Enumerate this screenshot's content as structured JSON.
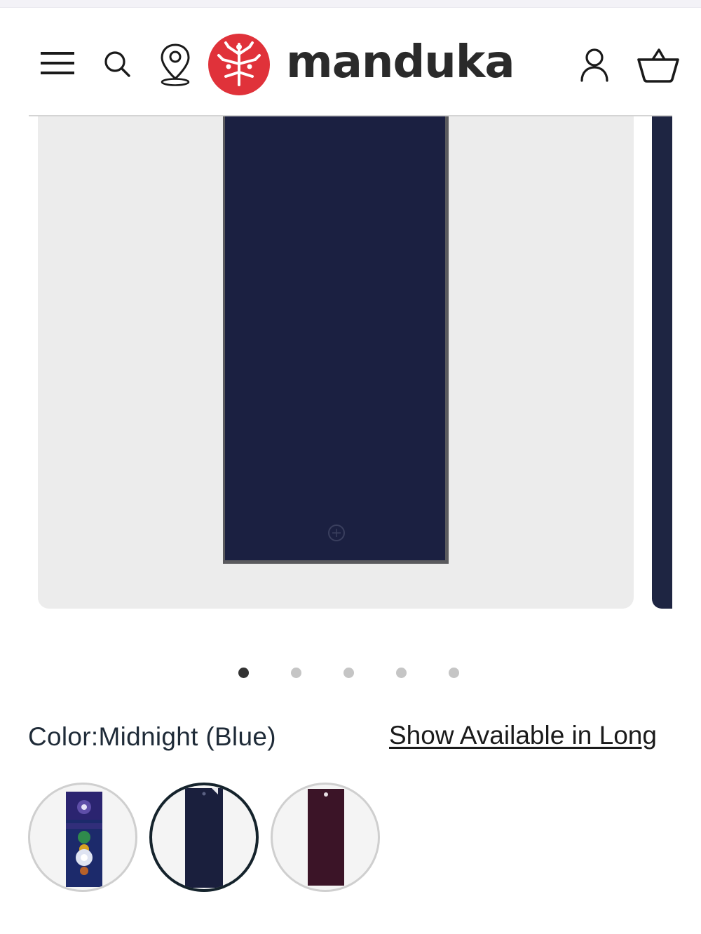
{
  "brand": {
    "name": "manduka",
    "logo_color": "#e0323a"
  },
  "header": {
    "icons": [
      "menu-icon",
      "search-icon",
      "location-pin-icon",
      "account-icon",
      "cart-basket-icon"
    ]
  },
  "gallery": {
    "current_slide": 1,
    "total_slides": 5,
    "product_color": "#1a1f3d"
  },
  "product": {
    "color_label": "Color:Midnight (Blue)",
    "long_link": "Show Available in Long"
  },
  "swatches": [
    {
      "name": "tie-dye",
      "selected": false
    },
    {
      "name": "Midnight (Blue)",
      "selected": true,
      "color": "#1a1f3d"
    },
    {
      "name": "plum",
      "selected": false,
      "color": "#3b1427"
    }
  ]
}
